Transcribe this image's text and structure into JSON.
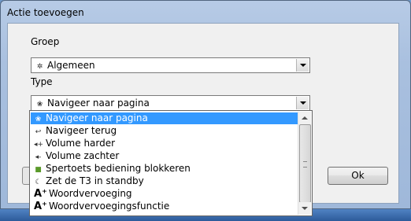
{
  "window": {
    "title": "Actie toevoegen"
  },
  "form": {
    "group_label": "Groep",
    "group_value": "Algemeen",
    "type_label": "Type",
    "type_value": "Navigeer naar pagina"
  },
  "dropdown": {
    "items": [
      {
        "label": "Navigeer naar pagina",
        "icon": "page-icon",
        "selected": true
      },
      {
        "label": "Navigeer terug",
        "icon": "back-arrow-icon",
        "selected": false
      },
      {
        "label": "Volume harder",
        "icon": "speaker-up-icon",
        "selected": false
      },
      {
        "label": "Volume zachter",
        "icon": "speaker-down-icon",
        "selected": false
      },
      {
        "label": "Spertoets bediening blokkeren",
        "icon": "lock-icon",
        "selected": false
      },
      {
        "label": "Zet de T3 in standby",
        "icon": "moon-icon",
        "selected": false
      },
      {
        "label": "Woordvervoeging",
        "icon": "letter-a-plus-icon",
        "selected": false
      },
      {
        "label": "Woordvervoegingsfunctie",
        "icon": "letter-a-function-icon",
        "selected": false
      }
    ]
  },
  "buttons": {
    "ok": "Ok"
  },
  "colors": {
    "selection": "#3399ff"
  }
}
